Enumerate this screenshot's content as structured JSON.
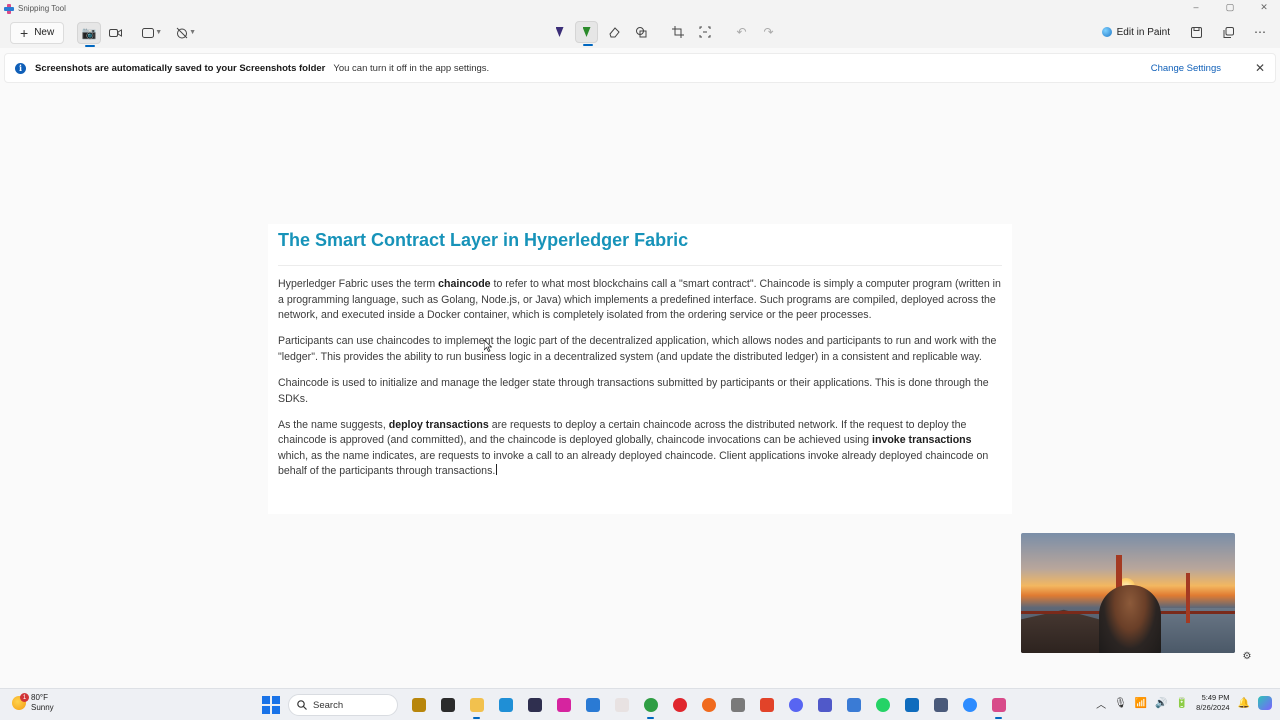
{
  "window": {
    "title": "Snipping Tool",
    "controls": [
      "–",
      "▢",
      "✕"
    ]
  },
  "toolbar": {
    "new_label": "New",
    "edit_in_paint_label": "Edit in Paint"
  },
  "infobar": {
    "title": "Screenshots are automatically saved to your Screenshots folder",
    "message": "You can turn it off in the app settings.",
    "link": "Change Settings",
    "close": "✕"
  },
  "document": {
    "title": "The Smart Contract Layer in Hyperledger Fabric",
    "p1": {
      "a": "Hyperledger Fabric uses the term ",
      "b": "chaincode",
      "c": " to refer to what most blockchains call a \"smart contract\". Chaincode is simply a computer program (written in a programming language, such as Golang, Node.js, or Java) which implements a predefined interface. Such programs are compiled, deployed across the network, and executed inside a Docker container, which is completely isolated from the ordering service or the peer processes."
    },
    "p2": "Participants can use chaincodes to implement the logic part of the decentralized application, which allows nodes and participants to run and work with the \"ledger\". This provides the ability to run business logic in a decentralized system (and update the distributed ledger) in a consistent and replicable way.",
    "p3": "Chaincode is used to initialize and manage the ledger state through transactions submitted by participants or their applications. This is done through the SDKs.",
    "p4": {
      "a": "As the name suggests, ",
      "b": "deploy transactions",
      "c": " are requests to deploy a certain chaincode across the distributed network. If the request to deploy the chaincode is approved (and committed), and the chaincode is deployed globally, chaincode invocations can be achieved using ",
      "d": "invoke transactions",
      "e": " which, as the name indicates, are requests to invoke a call to an already deployed chaincode. Client applications invoke already deployed chaincode on behalf of the participants through transactions."
    }
  },
  "taskbar": {
    "weather_temp": "80°F",
    "weather_cond": "Sunny",
    "weather_badge": "1",
    "search_label": "Search",
    "time": "5:49 PM",
    "date": "8/26/2024",
    "apps": [
      {
        "name": "file-explorer-icon",
        "color": "#b8860b"
      },
      {
        "name": "terminal-icon",
        "color": "#2b2b2b"
      },
      {
        "name": "folder-icon",
        "color": "#f2c14e"
      },
      {
        "name": "edge-icon",
        "color": "#1f8fd6"
      },
      {
        "name": "phone-icon",
        "color": "#2f2f4f"
      },
      {
        "name": "instagram-icon",
        "color": "#d6249f"
      },
      {
        "name": "store-icon",
        "color": "#2a7ad4"
      },
      {
        "name": "acrobat-icon",
        "color": "#e8e2e2"
      },
      {
        "name": "chrome-icon",
        "color": "#2f9e44"
      },
      {
        "name": "opera-icon",
        "color": "#e0262d"
      },
      {
        "name": "firefox-icon",
        "color": "#f06a1d"
      },
      {
        "name": "photos-icon",
        "color": "#7a7a7a"
      },
      {
        "name": "gitlab-icon",
        "color": "#e24329"
      },
      {
        "name": "discord-icon",
        "color": "#5865f2"
      },
      {
        "name": "teams-icon",
        "color": "#5059c9"
      },
      {
        "name": "copilot-icon",
        "color": "#3a7bd5"
      },
      {
        "name": "whatsapp-icon",
        "color": "#25d366"
      },
      {
        "name": "outlook-icon",
        "color": "#0f6cbd"
      },
      {
        "name": "settings-app-icon",
        "color": "#4a5a7a"
      },
      {
        "name": "zoom-icon",
        "color": "#2d8cff"
      },
      {
        "name": "snipping-tool-icon",
        "color": "#d84b8a"
      }
    ]
  }
}
